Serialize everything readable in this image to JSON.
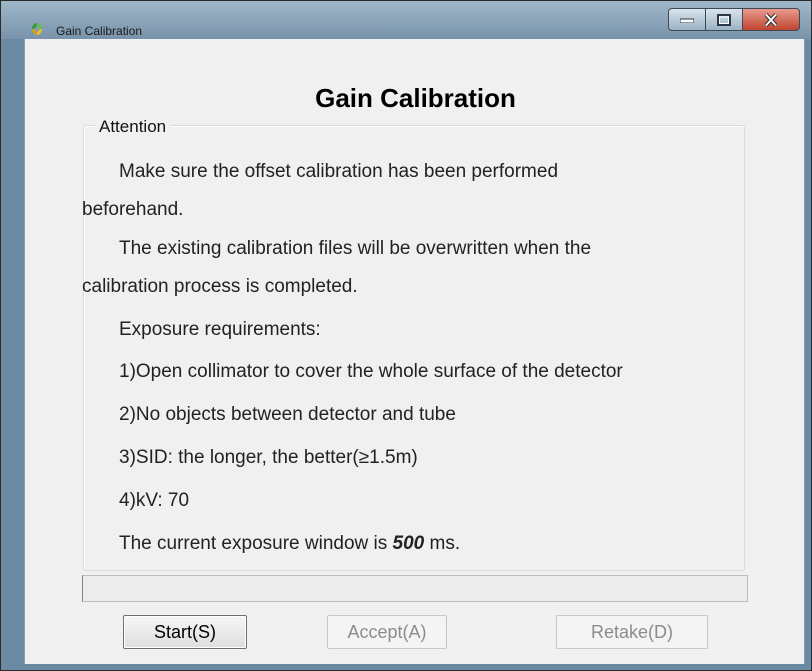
{
  "window": {
    "title": "Gain Calibration"
  },
  "dialog": {
    "heading": "Gain Calibration",
    "group_label": "Attention",
    "lines": [
      "Make sure the offset calibration has been performed",
      "beforehand.",
      "The existing calibration files will be overwritten when the",
      "calibration process is completed.",
      "Exposure requirements:",
      "1)Open collimator to cover the whole surface of the detector",
      "2)No objects between detector and tube",
      "3)SID: the longer, the better(≥1.5m)",
      "4)kV: 70"
    ],
    "exposure_prefix": "The current exposure window is ",
    "exposure_value": "500",
    "exposure_suffix": " ms.",
    "progress": 0
  },
  "buttons": {
    "start": "Start(S)",
    "accept": "Accept(A)",
    "retake": "Retake(D)"
  },
  "icons": {
    "app": "app-leaf-icon",
    "minimize": "minimize-icon",
    "maximize": "maximize-icon",
    "close": "close-icon"
  }
}
